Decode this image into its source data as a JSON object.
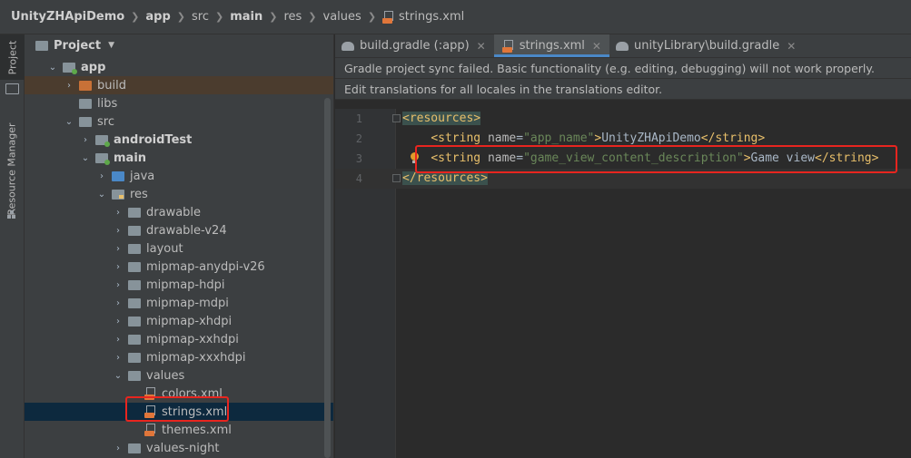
{
  "breadcrumb": {
    "items": [
      {
        "label": "UnityZHApiDemo",
        "bold": true
      },
      {
        "label": "app",
        "bold": true
      },
      {
        "label": "src",
        "bold": false
      },
      {
        "label": "main",
        "bold": true
      },
      {
        "label": "res",
        "bold": false
      },
      {
        "label": "values",
        "bold": false
      },
      {
        "label": "strings.xml",
        "bold": false
      }
    ]
  },
  "toolstrip": {
    "project_label": "Project",
    "resource_manager_label": "Resource Manager"
  },
  "project_panel": {
    "title": "Project",
    "tree": [
      {
        "label": "app",
        "bold": true
      },
      {
        "label": "build",
        "bold": false
      },
      {
        "label": "libs",
        "bold": false
      },
      {
        "label": "src",
        "bold": false
      },
      {
        "label": "androidTest",
        "bold": true
      },
      {
        "label": "main",
        "bold": true
      },
      {
        "label": "java",
        "bold": false
      },
      {
        "label": "res",
        "bold": false
      },
      {
        "label": "drawable",
        "bold": false
      },
      {
        "label": "drawable-v24",
        "bold": false
      },
      {
        "label": "layout",
        "bold": false
      },
      {
        "label": "mipmap-anydpi-v26",
        "bold": false
      },
      {
        "label": "mipmap-hdpi",
        "bold": false
      },
      {
        "label": "mipmap-mdpi",
        "bold": false
      },
      {
        "label": "mipmap-xhdpi",
        "bold": false
      },
      {
        "label": "mipmap-xxhdpi",
        "bold": false
      },
      {
        "label": "mipmap-xxxhdpi",
        "bold": false
      },
      {
        "label": "values",
        "bold": false
      },
      {
        "label": "colors.xml",
        "bold": false
      },
      {
        "label": "strings.xml",
        "bold": false
      },
      {
        "label": "themes.xml",
        "bold": false
      },
      {
        "label": "values-night",
        "bold": false
      }
    ]
  },
  "editor": {
    "tabs": [
      {
        "label": "build.gradle (:app)",
        "active": false
      },
      {
        "label": "strings.xml",
        "active": true
      },
      {
        "label": "unityLibrary\\build.gradle",
        "active": false
      }
    ],
    "banner_sync": "Gradle project sync failed. Basic functionality (e.g. editing, debugging) will not work properly.",
    "banner_translations": "Edit translations for all locales in the translations editor.",
    "lines": [
      {
        "number": "1",
        "open": "<",
        "tag": "resources",
        "close": ">"
      },
      {
        "number": "2",
        "indent": "    ",
        "lt": "<",
        "tag": "string",
        "attr": "name",
        "eq": "=",
        "value": "\"app_name\"",
        "gt": ">",
        "text": "UnityZHApiDemo",
        "end_lt": "</",
        "end_tag": "string",
        "end_gt": ">"
      },
      {
        "number": "3",
        "indent": "    ",
        "lt": "<",
        "tag": "string",
        "attr": "name",
        "eq": "=",
        "value": "\"game_view_content_description\"",
        "gt": ">",
        "text": "Game view",
        "end_lt": "</",
        "end_tag": "string",
        "end_gt": ">"
      },
      {
        "number": "4",
        "open": "</",
        "tag": "resources",
        "close": ">"
      }
    ]
  }
}
